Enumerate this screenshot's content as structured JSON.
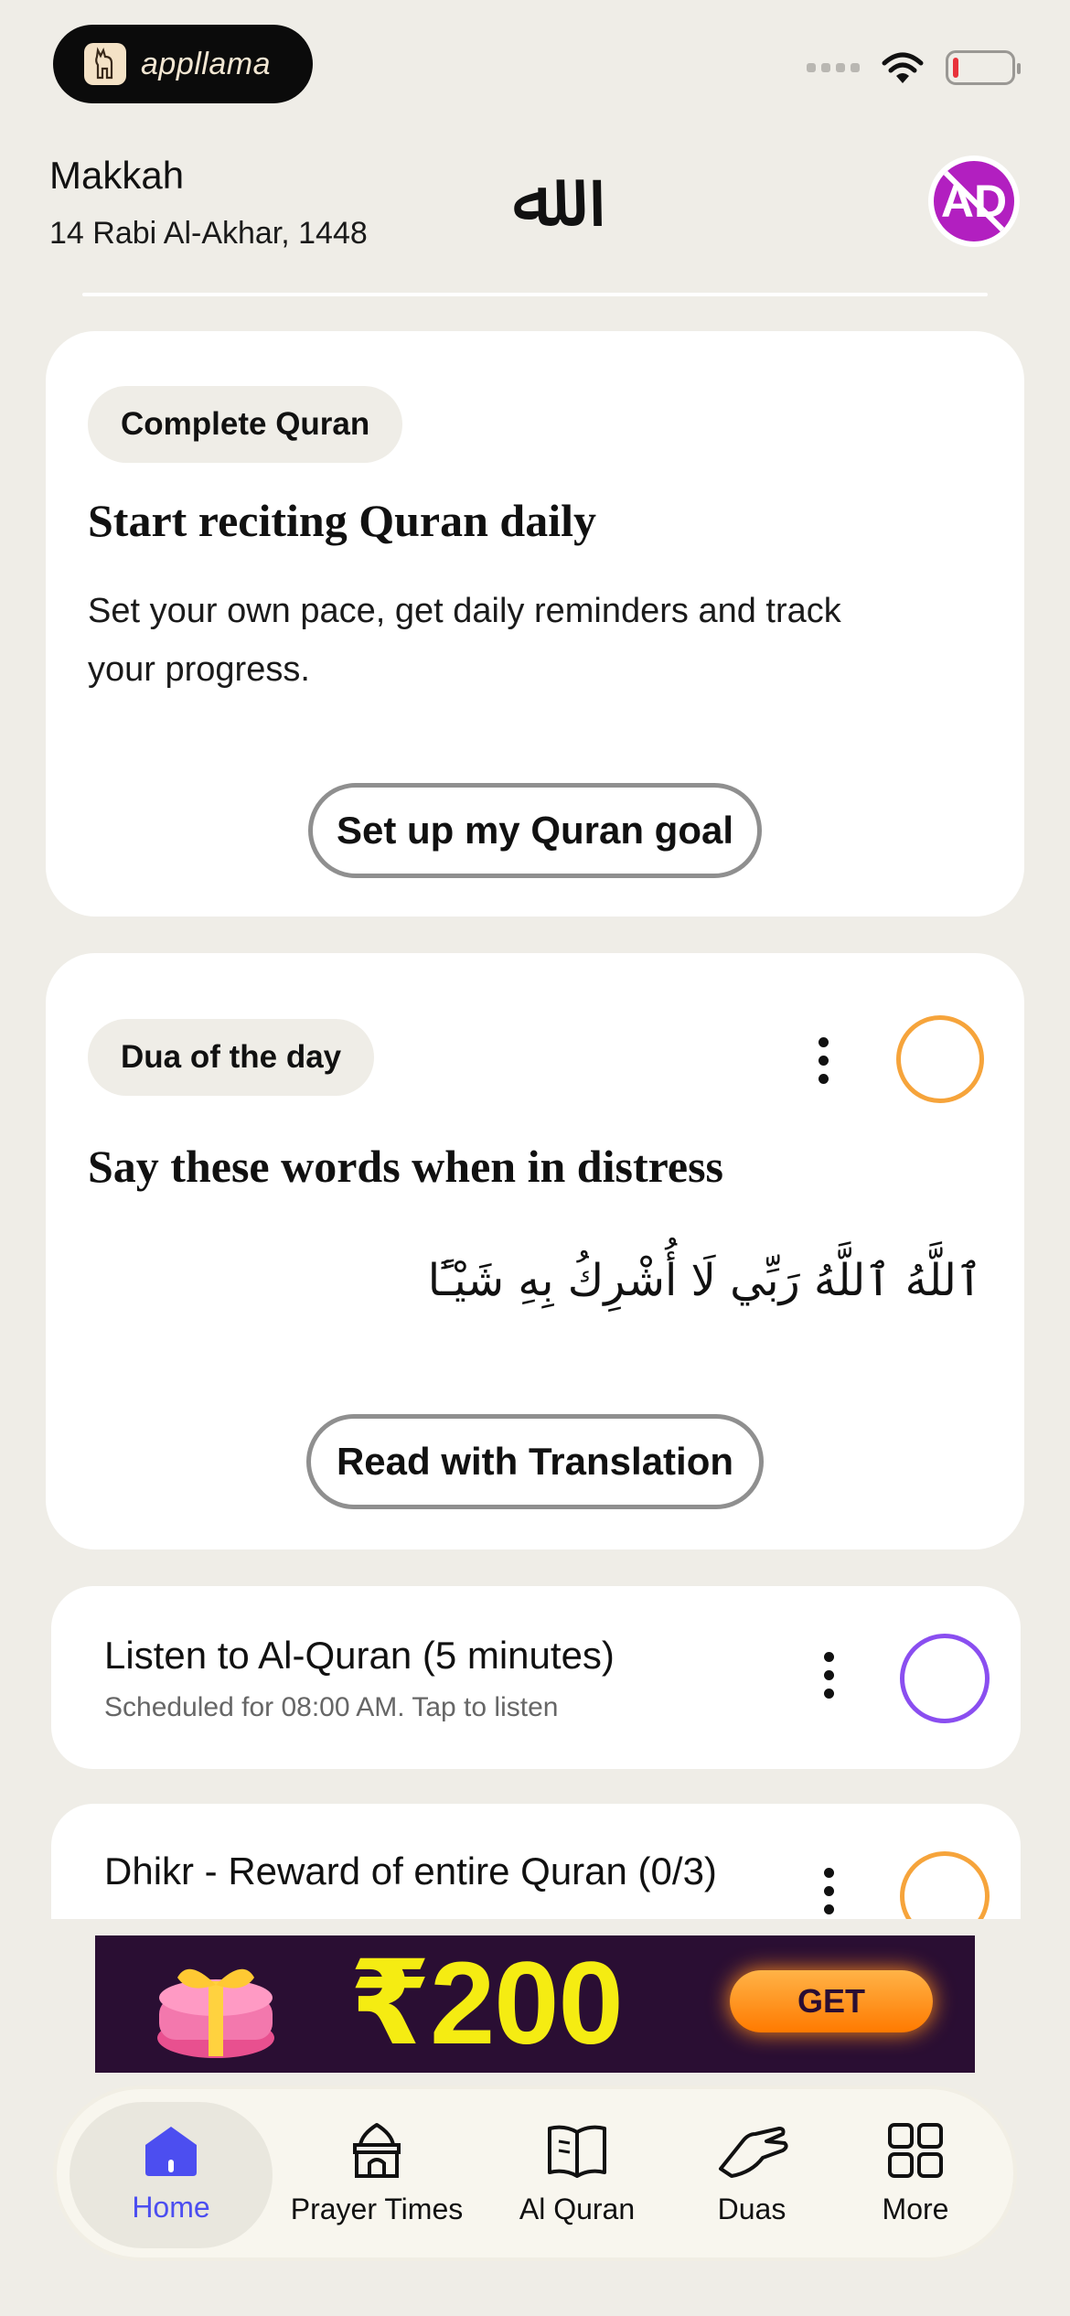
{
  "status_bar": {
    "app_logo_text": "appllama",
    "battery_icon": "battery-low-icon",
    "wifi_icon": "wifi-icon"
  },
  "header": {
    "city": "Makkah",
    "hijri_date": "14 Rabi Al-Akhar, 1448",
    "emblem": "ﷲ",
    "ad_badge": "AD"
  },
  "quran_goal_card": {
    "chip": "Complete Quran",
    "title": "Start reciting Quran daily",
    "body": "Set your own pace, get daily reminders and track your progress.",
    "button": "Set up my Quran goal"
  },
  "dua_card": {
    "chip": "Dua of the day",
    "title": "Say these words when in distress",
    "arabic": "ٱللَّهُ ٱللَّهُ رَبِّي لَا أُشْرِكُ بِهِ شَيْـًٔا",
    "button": "Read with Translation",
    "ring_color": "#f6a43b"
  },
  "tasks": [
    {
      "title": "Listen to Al-Quran (5 minutes)",
      "subtitle": "Scheduled for 08:00 AM. Tap to listen",
      "ring_color": "#8a4ef0"
    },
    {
      "title": "Dhikr - Reward of entire Quran (0/3)",
      "subtitle": "",
      "ring_color": "#f6a43b"
    }
  ],
  "banner": {
    "amount": "₹200",
    "cta": "GET"
  },
  "bottom_nav": {
    "items": [
      {
        "label": "Home",
        "icon": "home-icon",
        "active": true
      },
      {
        "label": "Prayer Times",
        "icon": "mosque-icon",
        "active": false
      },
      {
        "label": "Al Quran",
        "icon": "book-icon",
        "active": false
      },
      {
        "label": "Duas",
        "icon": "praying-hands-icon",
        "active": false
      },
      {
        "label": "More",
        "icon": "grid-icon",
        "active": false
      }
    ],
    "accent_color": "#4c4ef0"
  }
}
